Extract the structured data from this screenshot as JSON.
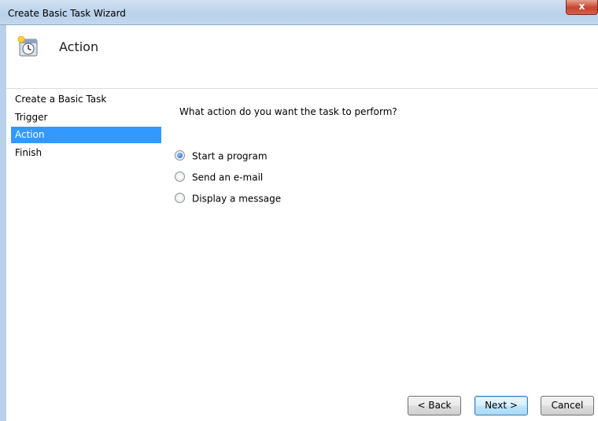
{
  "window": {
    "title": "Create Basic Task Wizard",
    "close_label": "x"
  },
  "header": {
    "title": "Action",
    "icon": "clock-icon"
  },
  "sidebar": {
    "items": [
      {
        "label": "Create a Basic Task",
        "selected": false
      },
      {
        "label": "Trigger",
        "selected": false
      },
      {
        "label": "Action",
        "selected": true
      },
      {
        "label": "Finish",
        "selected": false
      }
    ]
  },
  "content": {
    "question": "What action do you want the task to perform?",
    "options": [
      {
        "label": "Start a program",
        "checked": true
      },
      {
        "label": "Send an e-mail",
        "checked": false
      },
      {
        "label": "Display a message",
        "checked": false
      }
    ]
  },
  "buttons": {
    "back": "< Back",
    "next": "Next >",
    "cancel": "Cancel"
  },
  "colors": {
    "selection": "#3399ff",
    "titlebar": "#b9d1ea",
    "close": "#c7432f"
  }
}
